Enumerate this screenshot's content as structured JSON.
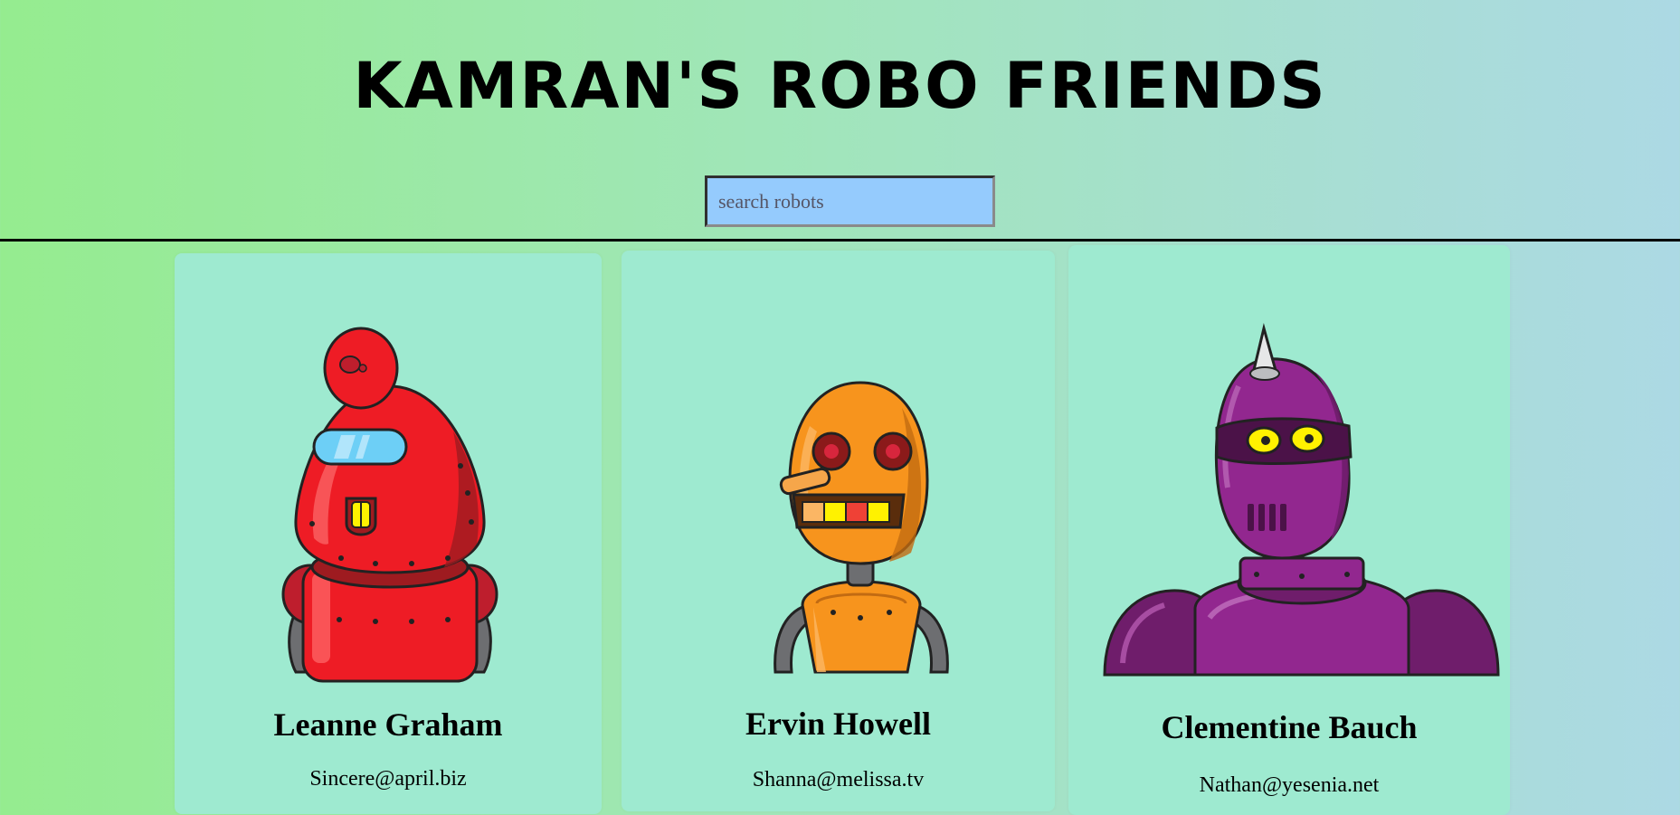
{
  "header": {
    "title": "KAMRAN'S ROBO FRIENDS"
  },
  "search": {
    "placeholder": "search robots",
    "value": ""
  },
  "robots": [
    {
      "name": "Leanne Graham",
      "email": "Sincere@april.biz",
      "color": "#ee1c25"
    },
    {
      "name": "Ervin Howell",
      "email": "Shanna@melissa.tv",
      "color": "#f7941d"
    },
    {
      "name": "Clementine Bauch",
      "email": "Nathan@yesenia.net",
      "color": "#92278f"
    }
  ],
  "colors": {
    "background_start": "#95ec8f",
    "background_end": "#acd9e4",
    "card": "#9eead0",
    "search": "#95cbfd"
  }
}
